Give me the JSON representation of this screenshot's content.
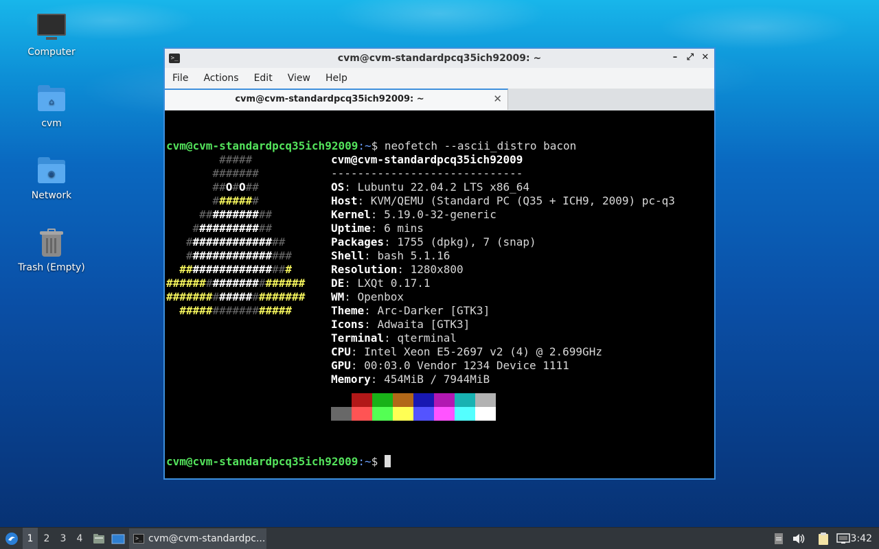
{
  "desktop": {
    "icons": [
      {
        "label": "Computer",
        "icon": "computer-icon"
      },
      {
        "label": "cvm",
        "icon": "home-folder-icon"
      },
      {
        "label": "Network",
        "icon": "network-folder-icon"
      },
      {
        "label": "Trash (Empty)",
        "icon": "trash-icon"
      }
    ]
  },
  "window": {
    "title": "cvm@cvm-standardpcq35ich92009: ~",
    "buttons": {
      "minimize": "–",
      "maximize": "⤢",
      "close": "✕"
    },
    "menu": [
      "File",
      "Actions",
      "Edit",
      "View",
      "Help"
    ],
    "tab": {
      "label": "cvm@cvm-standardpcq35ich92009: ~",
      "close": "✕"
    }
  },
  "terminal": {
    "prompt_user_host": "cvm@cvm-standardpcq35ich92009",
    "prompt_path": ":~",
    "prompt_symbol": "$ ",
    "command": "neofetch --ascii_distro bacon",
    "header": "cvm@cvm-standardpcq35ich92009",
    "separator": "-----------------------------",
    "info": [
      {
        "key": "OS",
        "value": "Lubuntu 22.04.2 LTS x86_64"
      },
      {
        "key": "Host",
        "value": "KVM/QEMU (Standard PC (Q35 + ICH9, 2009) pc-q3"
      },
      {
        "key": "Kernel",
        "value": "5.19.0-32-generic"
      },
      {
        "key": "Uptime",
        "value": "6 mins"
      },
      {
        "key": "Packages",
        "value": "1755 (dpkg), 7 (snap)"
      },
      {
        "key": "Shell",
        "value": "bash 5.1.16"
      },
      {
        "key": "Resolution",
        "value": "1280x800"
      },
      {
        "key": "DE",
        "value": "LXQt 0.17.1"
      },
      {
        "key": "WM",
        "value": "Openbox"
      },
      {
        "key": "Theme",
        "value": "Arc-Darker [GTK3]"
      },
      {
        "key": "Icons",
        "value": "Adwaita [GTK3]"
      },
      {
        "key": "Terminal",
        "value": "qterminal"
      },
      {
        "key": "CPU",
        "value": "Intel Xeon E5-2697 v2 (4) @ 2.699GHz"
      },
      {
        "key": "GPU",
        "value": "00:03.0 Vendor 1234 Device 1111"
      },
      {
        "key": "Memory",
        "value": "454MiB / 7944MiB"
      }
    ],
    "palette_row1": [
      "#000000",
      "#b21818",
      "#18b218",
      "#b26818",
      "#1818b2",
      "#b218b2",
      "#18b2b2",
      "#b2b2b2"
    ],
    "palette_row2": [
      "#686868",
      "#ff5454",
      "#54ff54",
      "#ffff54",
      "#5454ff",
      "#ff54ff",
      "#54ffff",
      "#ffffff"
    ]
  },
  "taskbar": {
    "start_icon": "lubuntu-start-icon",
    "desktops": [
      "1",
      "2",
      "3",
      "4"
    ],
    "active_desktop": "1",
    "task_label": "cvm@cvm-standardpc...",
    "clock": "3:42"
  }
}
